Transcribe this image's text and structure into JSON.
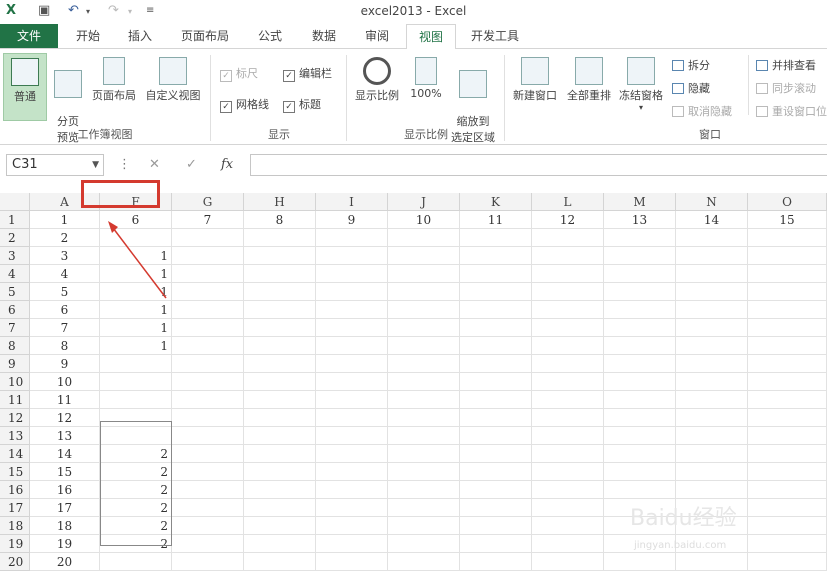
{
  "window": {
    "title": "excel2013 - Excel"
  },
  "tabs": [
    {
      "label": "文件"
    },
    {
      "label": "开始"
    },
    {
      "label": "插入"
    },
    {
      "label": "页面布局"
    },
    {
      "label": "公式"
    },
    {
      "label": "数据"
    },
    {
      "label": "审阅"
    },
    {
      "label": "视图"
    },
    {
      "label": "开发工具"
    }
  ],
  "ribbon": {
    "workbook_views": {
      "normal": "普通",
      "page_break": "分页\n预览",
      "page_layout": "页面布局",
      "custom": "自定义视图",
      "group": "工作簿视图"
    },
    "show": {
      "ruler": "标尺",
      "formula_bar": "编辑栏",
      "gridlines": "网格线",
      "headings": "标题",
      "group": "显示"
    },
    "zoom": {
      "zoom": "显示比例",
      "hundred": "100%",
      "to_selection": "缩放到\n选定区域",
      "group": "显示比例"
    },
    "window": {
      "new_window": "新建窗口",
      "arrange_all": "全部重排",
      "freeze": "冻结窗格",
      "split": "拆分",
      "hide": "隐藏",
      "unhide": "取消隐藏",
      "side_by_side": "并排查看",
      "sync_scroll": "同步滚动",
      "reset_position": "重设窗口位置",
      "group": "窗口"
    }
  },
  "formula_bar": {
    "name_box": "C31",
    "fx": "fx",
    "cancel": "✕",
    "enter": "✓"
  },
  "sheet": {
    "columns": [
      "A",
      "F",
      "G",
      "H",
      "I",
      "J",
      "K",
      "L",
      "M",
      "N",
      "O"
    ],
    "row1": [
      "1",
      "6",
      "7",
      "8",
      "9",
      "10",
      "11",
      "12",
      "13",
      "14",
      "15"
    ],
    "colA": [
      "2",
      "3",
      "4",
      "5",
      "6",
      "7",
      "8",
      "9",
      "10",
      "11",
      "12",
      "13",
      "14",
      "15",
      "16",
      "17",
      "18",
      "19",
      "20"
    ],
    "colF": {
      "3": "1",
      "4": "1",
      "5": "1",
      "6": "1",
      "7": "1",
      "8": "1",
      "14": "2",
      "15": "2",
      "16": "2",
      "17": "2",
      "18": "2",
      "19": "2"
    },
    "row_numbers": [
      "1",
      "2",
      "3",
      "4",
      "5",
      "6",
      "7",
      "8",
      "9",
      "10",
      "11",
      "12",
      "13",
      "14",
      "15",
      "16",
      "17",
      "18",
      "19",
      "20"
    ]
  },
  "watermark": {
    "brand": "Baidu经验",
    "url": "jingyan.baidu.com"
  }
}
